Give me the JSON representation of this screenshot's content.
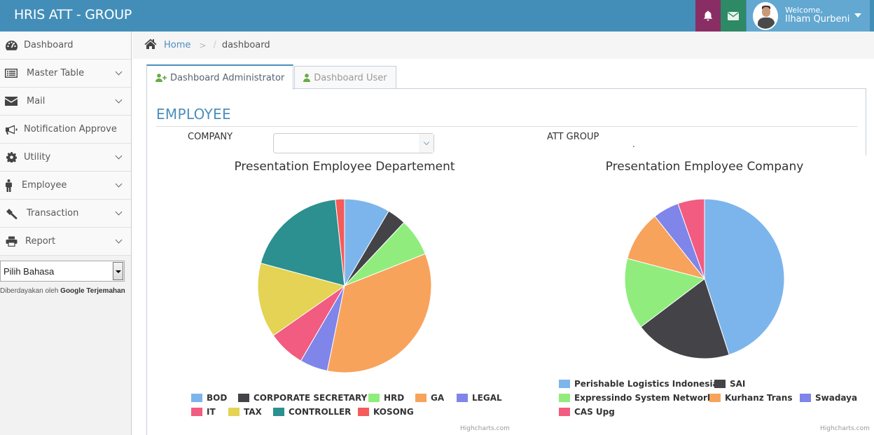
{
  "app": {
    "title": "HRIS ATT - GROUP"
  },
  "topbar": {
    "bell_icon": "bell-icon",
    "mail_icon": "envelope-icon",
    "welcome": "Welcome,",
    "user_name": "Ilham Qurbeni",
    "colors": {
      "bar": "#438eb9",
      "bell": "#892e65",
      "mail": "#2e8965",
      "user": "#62a8d1"
    }
  },
  "sidebar": {
    "items": [
      {
        "label": "Dashboard",
        "icon": "tachometer-icon",
        "has_submenu": false
      },
      {
        "label": "Master Table",
        "icon": "list-icon",
        "has_submenu": true
      },
      {
        "label": "Mail",
        "icon": "envelope-icon",
        "has_submenu": true
      },
      {
        "label": "Notification Approve",
        "icon": "bullhorn-icon",
        "has_submenu": false
      },
      {
        "label": "Utility",
        "icon": "gear-icon",
        "has_submenu": true
      },
      {
        "label": "Employee",
        "icon": "male-icon",
        "has_submenu": true
      },
      {
        "label": "Transaction",
        "icon": "gavel-icon",
        "has_submenu": true
      },
      {
        "label": "Report",
        "icon": "print-icon",
        "has_submenu": true
      }
    ],
    "language_select": {
      "value": "Pilih Bahasa"
    },
    "powered_by": {
      "prefix": "Diberdayakan oleh",
      "brand": "Google Terjemahan"
    }
  },
  "breadcrumb": {
    "home": "Home",
    "current": "dashboard"
  },
  "tabs": [
    {
      "label": "Dashboard Administrator",
      "icon": "user-plus-icon",
      "active": true
    },
    {
      "label": "Dashboard User",
      "icon": "user-icon",
      "active": false
    }
  ],
  "section": {
    "title": "EMPLOYEE",
    "company_label": "COMPANY",
    "company_value": "",
    "att_group_label": "ATT GROUP",
    "att_group_value": "."
  },
  "chart_data": [
    {
      "type": "pie",
      "title": "Presentation Employee Departement",
      "legend_position": "bottom",
      "credits": "Highcharts.com",
      "categories": [
        "BOD",
        "CORPORATE SECRETARY",
        "HRD",
        "GA",
        "LEGAL",
        "IT",
        "TAX",
        "CONTROLLER",
        "KOSONG"
      ],
      "values": [
        8.5,
        3.5,
        7.0,
        34.2,
        5.2,
        6.9,
        13.9,
        19.1,
        1.7
      ],
      "unit": "percent (estimated)",
      "colors": [
        "#7cb5ec",
        "#434348",
        "#90ed7d",
        "#f7a35c",
        "#8085e9",
        "#f15c80",
        "#e4d354",
        "#2b908f",
        "#f45b5b"
      ]
    },
    {
      "type": "pie",
      "title": "Presentation Employee Company",
      "legend_position": "bottom",
      "credits": "Highcharts.com",
      "categories": [
        "Perishable Logistics Indonesia",
        "SAI",
        "Expressindo System Network",
        "Kurhanz Trans",
        "Swadaya",
        "CAS Upg"
      ],
      "values": [
        45.0,
        19.7,
        14.4,
        10.2,
        5.3,
        5.4
      ],
      "unit": "percent (estimated)",
      "colors": [
        "#7cb5ec",
        "#434348",
        "#90ed7d",
        "#f7a35c",
        "#8085e9",
        "#f15c80"
      ]
    }
  ]
}
